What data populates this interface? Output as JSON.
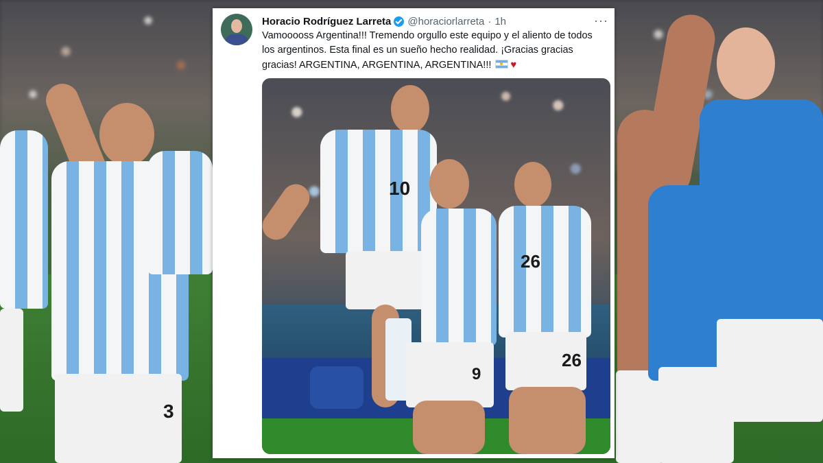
{
  "tweet": {
    "name": "Horacio Rodríguez Larreta",
    "handle": "@horaciorlarreta",
    "separator": "·",
    "time": "1h",
    "more": "···",
    "text": "Vamooooss Argentina!!! Tremendo orgullo este equipo y el aliento de todos los argentinos. Esta final es un sueño hecho realidad.  ¡Gracias gracias gracias! ARGENTINA, ARGENTINA, ARGENTINA!!!",
    "heart": "♥"
  },
  "photo_numbers": {
    "messi_chest": "10",
    "alvarez_shorts": "9",
    "enzo_chest": "26",
    "enzo_shorts": "26",
    "bg_left_shorts": "3"
  },
  "colors": {
    "verified": "#1d9bf0",
    "argentina_blue": "#74acdf",
    "heart": "#d0142c"
  }
}
